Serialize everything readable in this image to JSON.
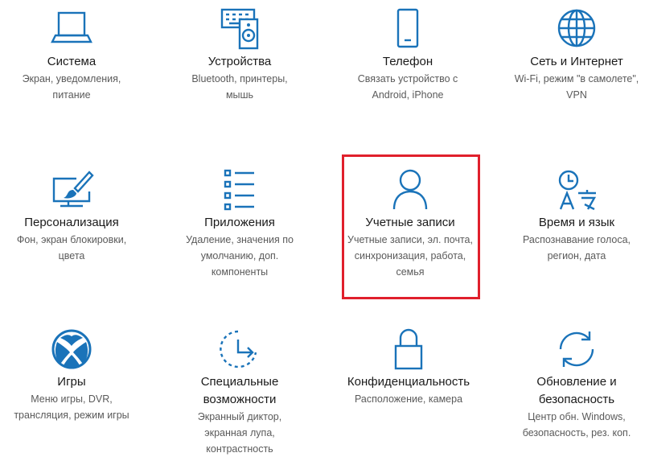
{
  "colors": {
    "accent": "#1a73b9",
    "highlight": "#e0202c"
  },
  "tiles": [
    {
      "id": "system",
      "icon": "laptop-icon",
      "title": "Система",
      "desc": [
        "Экран, уведомления,",
        "питание"
      ]
    },
    {
      "id": "devices",
      "icon": "devices-icon",
      "title": "Устройства",
      "desc": [
        "Bluetooth, принтеры,",
        "мышь"
      ]
    },
    {
      "id": "phone",
      "icon": "phone-icon",
      "title": "Телефон",
      "desc": [
        "Связать устройство с",
        "Android, iPhone"
      ]
    },
    {
      "id": "network",
      "icon": "globe-icon",
      "title": "Сеть и Интернет",
      "desc": [
        "Wi-Fi, режим \"в самолете\",",
        "VPN"
      ]
    },
    {
      "id": "personalization",
      "icon": "paintbrush-icon",
      "title": "Персонализация",
      "desc": [
        "Фон, экран блокировки,",
        "цвета"
      ]
    },
    {
      "id": "apps",
      "icon": "apps-list-icon",
      "title": "Приложения",
      "desc": [
        "Удаление, значения по",
        "умолчанию, доп.",
        "компоненты"
      ]
    },
    {
      "id": "accounts",
      "icon": "person-icon",
      "title": "Учетные записи",
      "desc": [
        "Учетные записи, эл. почта,",
        "синхронизация, работа,",
        "семья"
      ]
    },
    {
      "id": "time-language",
      "icon": "time-language-icon",
      "title": "Время и язык",
      "desc": [
        "Распознавание голоса,",
        "регион, дата"
      ]
    },
    {
      "id": "gaming",
      "icon": "xbox-icon",
      "title": "Игры",
      "desc": [
        "Меню игры, DVR,",
        "трансляция, режим игры"
      ]
    },
    {
      "id": "ease-of-access",
      "icon": "ease-of-access-icon",
      "title": "Специальные возможности",
      "title_lines": [
        "Специальные",
        "возможности"
      ],
      "desc": [
        "Экранный диктор,",
        "экранная лупа,",
        "контрастность"
      ]
    },
    {
      "id": "privacy",
      "icon": "lock-icon",
      "title": "Конфиденциальность",
      "desc": [
        "Расположение, камера"
      ]
    },
    {
      "id": "update-security",
      "icon": "sync-icon",
      "title": "Обновление и безопасность",
      "title_lines": [
        "Обновление и",
        "безопасность"
      ],
      "desc": [
        "Центр обн. Windows,",
        "безопасность, рез. коп."
      ]
    }
  ]
}
